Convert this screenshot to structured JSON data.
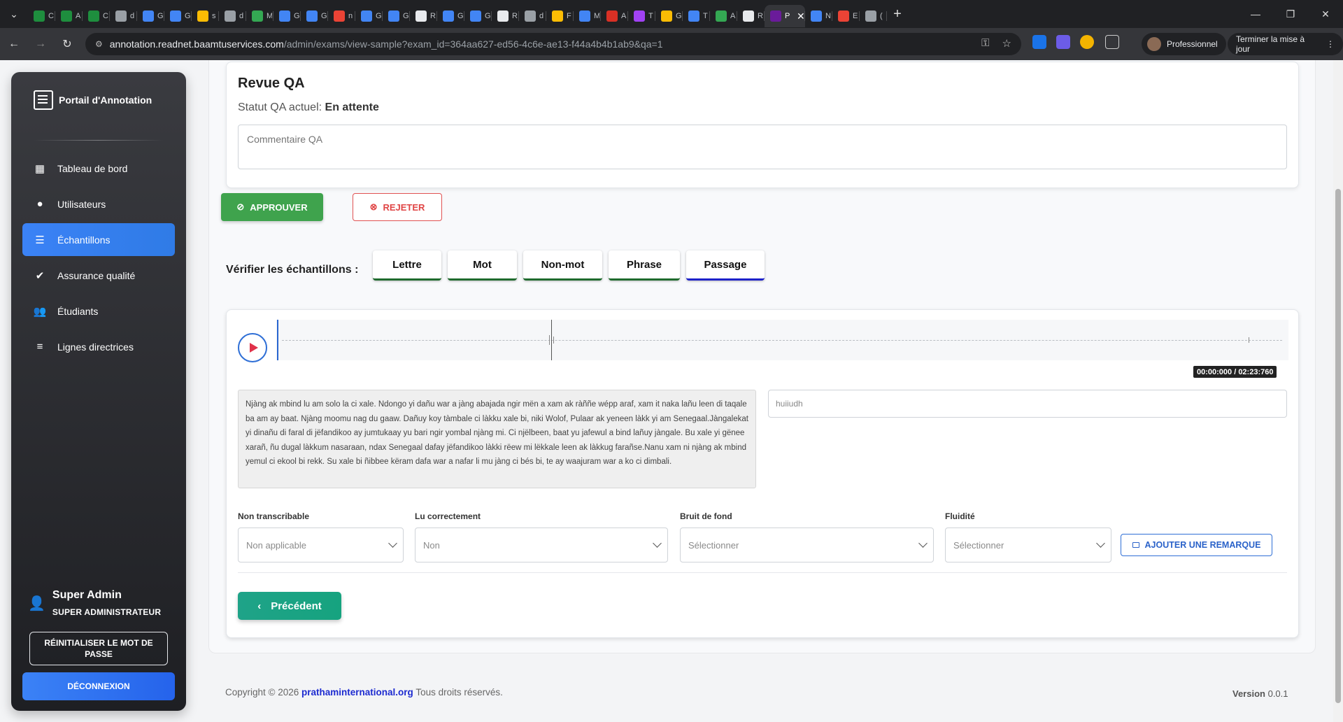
{
  "browser": {
    "tabs": [
      {
        "letter": "C",
        "color": "#1e8e3e"
      },
      {
        "letter": "A",
        "color": "#1e8e3e"
      },
      {
        "letter": "C",
        "color": "#1e8e3e"
      },
      {
        "letter": "d",
        "color": "#9aa0a6"
      },
      {
        "letter": "G",
        "color": "#4285f4"
      },
      {
        "letter": "G",
        "color": "#4285f4"
      },
      {
        "letter": "s",
        "color": "#fbbc04"
      },
      {
        "letter": "d",
        "color": "#9aa0a6"
      },
      {
        "letter": "M",
        "color": "#34a853"
      },
      {
        "letter": "G",
        "color": "#4285f4"
      },
      {
        "letter": "G",
        "color": "#4285f4"
      },
      {
        "letter": "n",
        "color": "#ea4335"
      },
      {
        "letter": "G",
        "color": "#4285f4"
      },
      {
        "letter": "G",
        "color": "#4285f4"
      },
      {
        "letter": "R",
        "color": "#e8eaed"
      },
      {
        "letter": "G",
        "color": "#4285f4"
      },
      {
        "letter": "G",
        "color": "#4285f4"
      },
      {
        "letter": "R",
        "color": "#e8eaed"
      },
      {
        "letter": "d",
        "color": "#9aa0a6"
      },
      {
        "letter": "F",
        "color": "#fbbc04"
      },
      {
        "letter": "M",
        "color": "#4285f4"
      },
      {
        "letter": "A",
        "color": "#d93025"
      },
      {
        "letter": "T",
        "color": "#a142f4"
      },
      {
        "letter": "G",
        "color": "#fbbc04"
      },
      {
        "letter": "T",
        "color": "#4285f4"
      },
      {
        "letter": "A",
        "color": "#34a853"
      },
      {
        "letter": "R",
        "color": "#e8eaed"
      }
    ],
    "active_tab": {
      "letter": "P",
      "color": "#6a1b9a"
    },
    "tabs_after": [
      {
        "letter": "N",
        "color": "#4285f4"
      },
      {
        "letter": "E",
        "color": "#ea4335"
      },
      {
        "letter": "(",
        "color": "#9aa0a6"
      }
    ],
    "url_host": "annotation.readnet.baamtuservices.com",
    "url_path": "/admin/exams/view-sample?exam_id=364aa627-ed56-4c6e-ae13-f44a4b4b1ab9&qa=1",
    "profile_label": "Professionnel",
    "update_label": "Terminer la mise à jour"
  },
  "sidebar": {
    "brand": "Portail d'Annotation",
    "items": [
      {
        "label": "Tableau de bord",
        "icon": "dashboard-icon",
        "glyph": "▦"
      },
      {
        "label": "Utilisateurs",
        "icon": "users-icon",
        "glyph": "●"
      },
      {
        "label": "Échantillons",
        "icon": "samples-icon",
        "glyph": "☰"
      },
      {
        "label": "Assurance qualité",
        "icon": "verified-icon",
        "glyph": "✔"
      },
      {
        "label": "Étudiants",
        "icon": "students-icon",
        "glyph": "👥"
      },
      {
        "label": "Lignes directrices",
        "icon": "guidelines-icon",
        "glyph": "≡"
      }
    ],
    "active_index": 2,
    "user_name": "Super Admin",
    "user_role": "SUPER ADMINISTRATEUR",
    "reset_label": "RÉINITIALISER LE MOT DE PASSE",
    "logout_label": "DÉCONNEXION"
  },
  "qa": {
    "title": "Revue QA",
    "status_label": "Statut QA actuel:",
    "status_value": "En attente",
    "comment_placeholder": "Commentaire QA",
    "approve_label": "APPROUVER",
    "reject_label": "REJETER"
  },
  "verify": {
    "label": "Vérifier les échantillons :",
    "buttons": [
      "Lettre",
      "Mot",
      "Non-mot",
      "Phrase",
      "Passage"
    ],
    "active": "Passage"
  },
  "sample": {
    "time": "00:00:000 / 02:23:760",
    "transcript": "Njàng ak mbind lu am solo la ci xale. Ndongo yi dañu war a jàng abajada ngir mën a xam ak ràññe wépp araf, xam it naka lañu leen di taqale ba am ay baat. Njàng moomu nag du gaaw. Dañuy koy tàmbale ci làkku xale bi, niki Wolof, Pulaar ak yeneen làkk yi am Senegaal.Jàngalekat yi dinañu di faral di jëfandikoo ay jumtukaay yu bari ngir yombal njàng mi. Ci njëlbeen, baat yu jafewul a bind lañuy jàngale. Bu xale yi gënee xarañ, ñu dugal làkkum nasaraan, ndax Senegaal dafay jëfandikoo làkki rëew mi lëkkale leen ak làkkug farañse.Nanu xam ni njàng ak mbind yemul ci ekool bi rekk. Su xale bi ñibbee këram dafa war a nafar li mu jàng ci bés bi, te ay waajuram war a ko ci dimbali.",
    "answer_value": "huiiudh",
    "fields": [
      {
        "label": "Non transcribable",
        "value": "Non applicable"
      },
      {
        "label": "Lu correctement",
        "value": "Non"
      },
      {
        "label": "Bruit de fond",
        "value": "Sélectionner"
      },
      {
        "label": "Fluidité",
        "value": "Sélectionner"
      }
    ],
    "remark_label": "AJOUTER UNE REMARQUE",
    "prev_label": "Précédent"
  },
  "footer": {
    "copyright": "Copyright © 2026",
    "link": "prathaminternational.org",
    "rights": "Tous droits réservés.",
    "version_label": "Version",
    "version_value": "0.0.1"
  },
  "colors": {
    "accent": "#3b82f6",
    "approve": "#3fa34d",
    "reject": "#e04545",
    "prev": "#16a37f"
  }
}
